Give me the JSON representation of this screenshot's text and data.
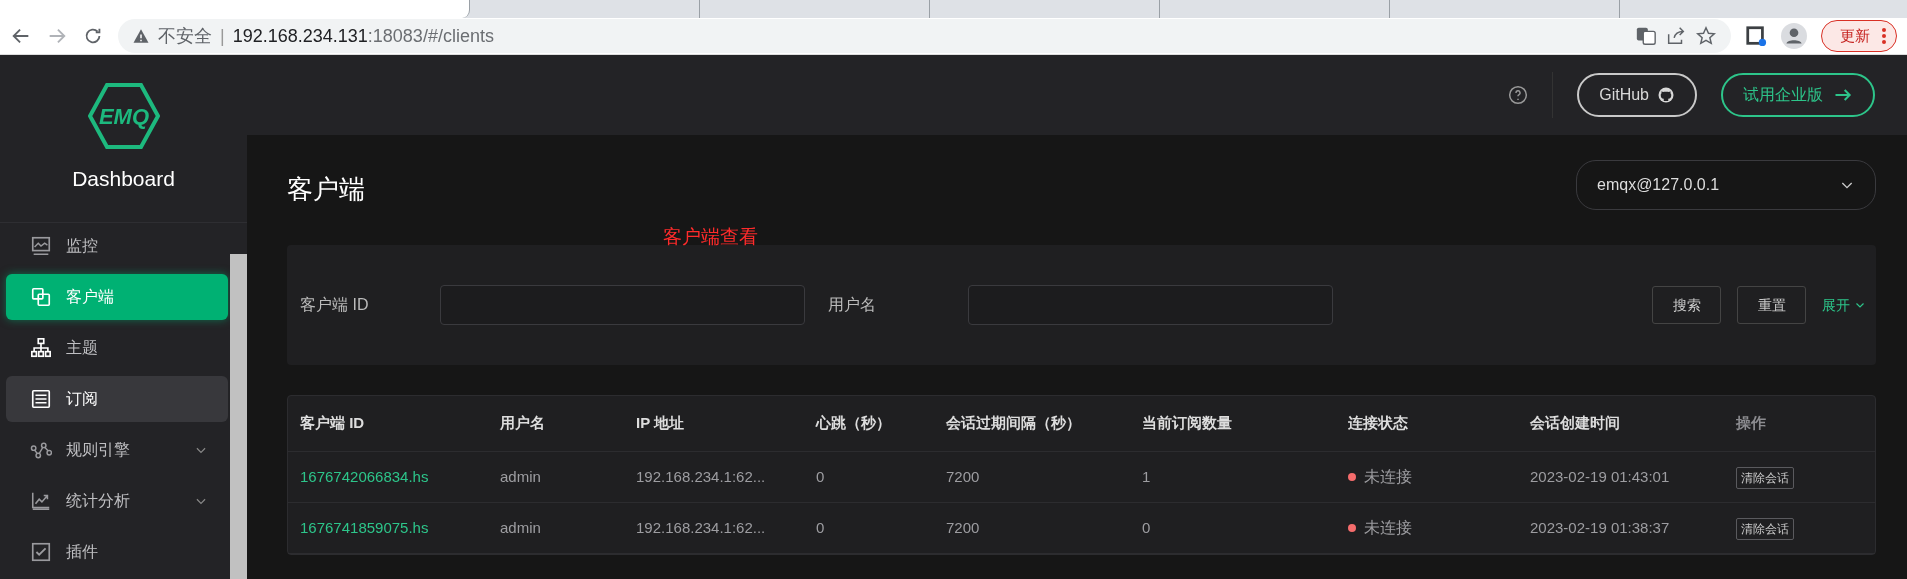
{
  "browser": {
    "tabs": [
      {
        "selected": true
      },
      {
        "selected": false
      },
      {
        "selected": false
      },
      {
        "selected": false
      },
      {
        "selected": false
      },
      {
        "selected": false
      }
    ],
    "security_label": "不安全",
    "separator": "|",
    "url_host": "192.168.234.131",
    "url_rest": ":18083/#/clients",
    "update_button": "更新"
  },
  "sidebar": {
    "logo_text": "EMQ",
    "title": "Dashboard",
    "items": [
      {
        "label": "监控",
        "selected": false,
        "hovered": false,
        "expandable": false
      },
      {
        "label": "客户端",
        "selected": true,
        "hovered": false,
        "expandable": false
      },
      {
        "label": "主题",
        "selected": false,
        "hovered": false,
        "expandable": false
      },
      {
        "label": "订阅",
        "selected": false,
        "hovered": true,
        "expandable": false
      },
      {
        "label": "规则引擎",
        "selected": false,
        "hovered": false,
        "expandable": true
      },
      {
        "label": "统计分析",
        "selected": false,
        "hovered": false,
        "expandable": true
      },
      {
        "label": "插件",
        "selected": false,
        "hovered": false,
        "expandable": false
      }
    ]
  },
  "header": {
    "github_button": "GitHub",
    "enterprise_button": "试用企业版"
  },
  "page": {
    "title": "客户端",
    "node_select": "emqx@127.0.0.1",
    "annotation": "客户端查看"
  },
  "filter": {
    "fields": [
      {
        "label": "客户端 ID"
      },
      {
        "label": "用户名"
      }
    ],
    "search_button": "搜索",
    "reset_button": "重置",
    "expand_link": "展开"
  },
  "table": {
    "columns": [
      "客户端 ID",
      "用户名",
      "IP 地址",
      "心跳（秒）",
      "会话过期间隔（秒）",
      "当前订阅数量",
      "连接状态",
      "会话创建时间",
      "操作"
    ],
    "rows": [
      {
        "client_id": "1676742066834.hs",
        "username": "admin",
        "ip": "192.168.234.1:62...",
        "keepalive": "0",
        "expiry": "7200",
        "subscriptions": "1",
        "connected": false,
        "status": "未连接",
        "created": "2023-02-19 01:43:01",
        "action": "清除会话"
      },
      {
        "client_id": "1676741859075.hs",
        "username": "admin",
        "ip": "192.168.234.1:62...",
        "keepalive": "0",
        "expiry": "7200",
        "subscriptions": "0",
        "connected": false,
        "status": "未连接",
        "created": "2023-02-19 01:38:37",
        "action": "清除会话"
      }
    ]
  }
}
